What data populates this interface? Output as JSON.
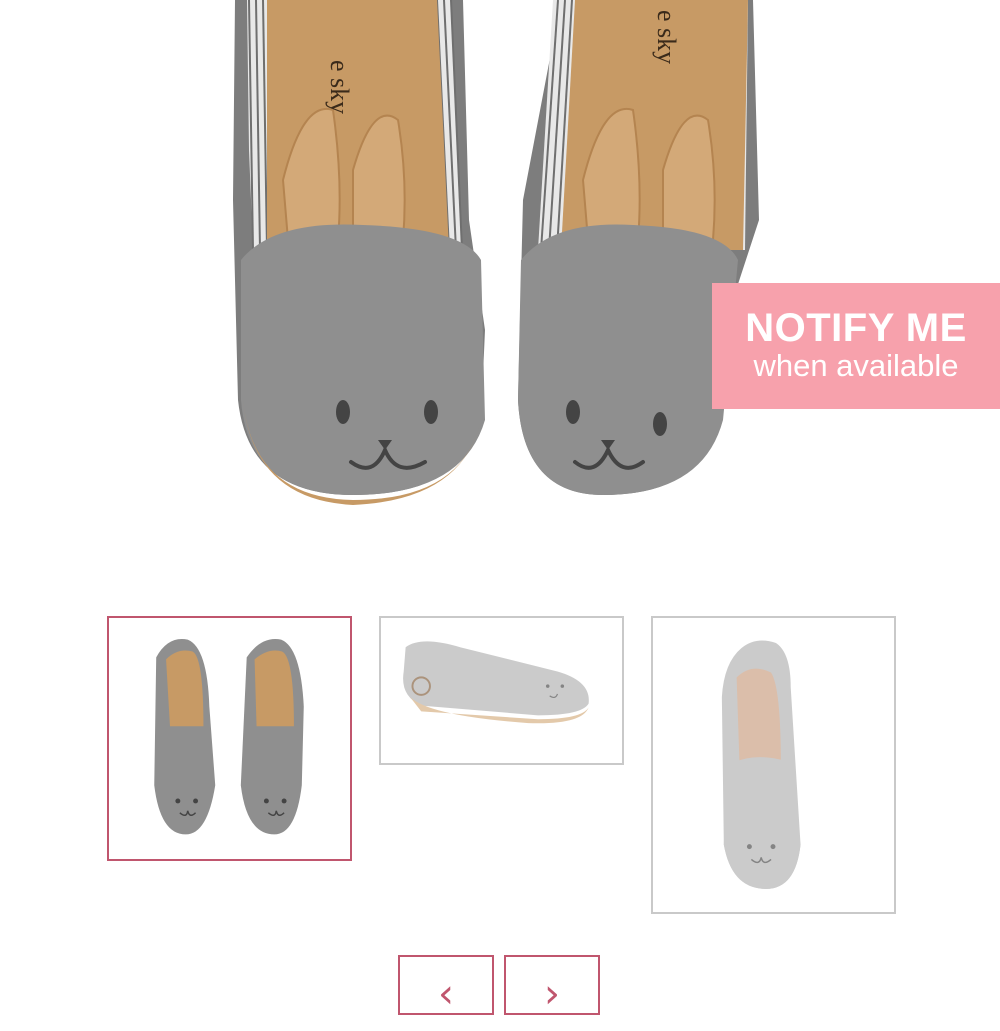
{
  "product": {
    "brand_insole_left": "e sky",
    "brand_insole_right": "e sky"
  },
  "notify": {
    "line1": "NOTIFY ME",
    "line2": "when available"
  },
  "gallery": {
    "selected_index": 0,
    "thumbnails": [
      {
        "view": "top-pair"
      },
      {
        "view": "side"
      },
      {
        "view": "angle-single"
      }
    ]
  },
  "navigation": {
    "prev_icon": "‹",
    "next_icon": "›"
  },
  "colors": {
    "accent": "#c0566e",
    "badge": "#f7a1ac",
    "felt_gray": "#8f8f8f",
    "insole_tan": "#c79a65"
  }
}
